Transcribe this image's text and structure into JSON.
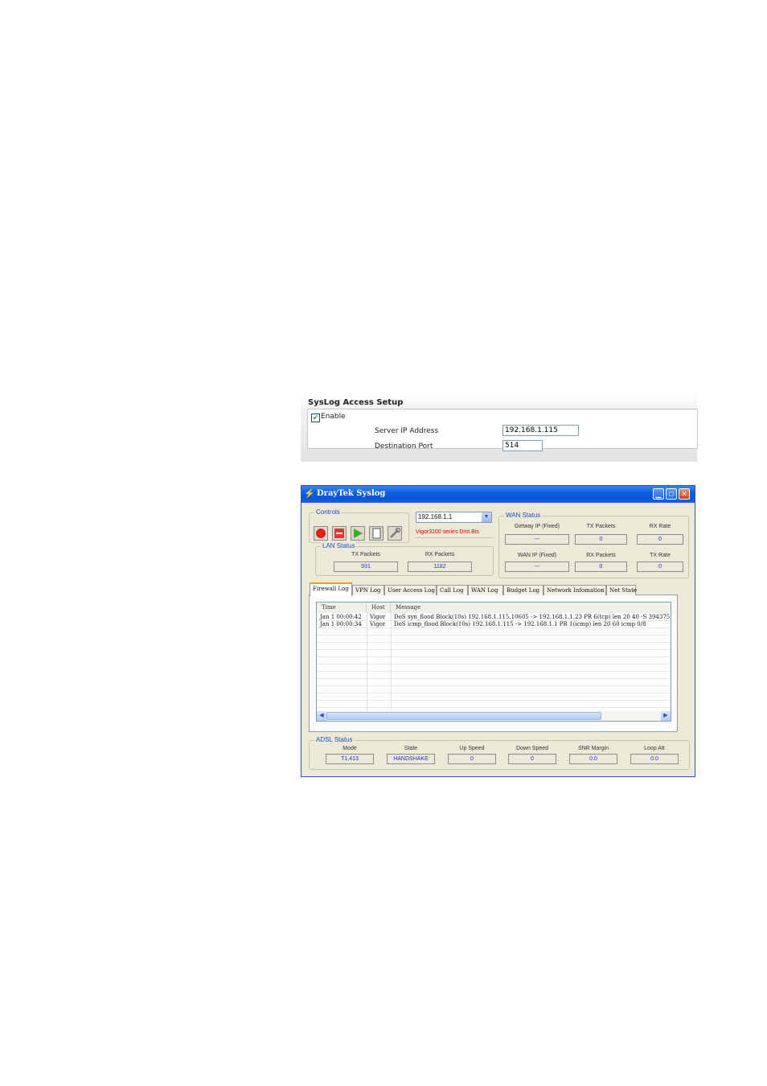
{
  "syslog_setup": {
    "title": "SysLog Access Setup",
    "enable_label": "Enable",
    "enable_checked": true,
    "server_ip_label": "Server IP Address",
    "server_ip_value": "192.168.1.115",
    "dest_port_label": "Destination Port",
    "dest_port_value": "514"
  },
  "window": {
    "title": "DrayTek Syslog",
    "controls_label": "Controls",
    "device_ip": "192.168.1.1",
    "model_text": "Vigor3100   series Dmt.Bis",
    "lan_status": {
      "label": "LAN Status",
      "tx_label": "TX Packets",
      "rx_label": "RX Packets",
      "tx_value": "931",
      "rx_value": "1182"
    },
    "wan_status": {
      "label": "WAN Status",
      "gateway_label": "Getway IP (Fixed)",
      "gateway_value": "---",
      "tx_packets_label": "TX Packets",
      "tx_packets_value": "0",
      "rx_rate_label": "RX Rate",
      "rx_rate_value": "0",
      "wan_ip_label": "WAN IP (Fixed)",
      "wan_ip_value": "---",
      "rx_packets_label": "RX Packets",
      "rx_packets_value": "0",
      "tx_rate_label": "TX Rate",
      "tx_rate_value": "0"
    },
    "tabs": [
      {
        "label": "Firewall Log",
        "active": true
      },
      {
        "label": "VPN Log"
      },
      {
        "label": "User Access Log"
      },
      {
        "label": "Call Log"
      },
      {
        "label": "WAN Log"
      },
      {
        "label": "Budget Log"
      },
      {
        "label": "Network Infomation"
      },
      {
        "label": "Net State"
      }
    ],
    "log": {
      "columns": [
        "Time",
        "Host",
        "Message"
      ],
      "rows": [
        {
          "time": "Jan  1 00:00:42",
          "host": "Vigor",
          "message": "DoS syn_flood Block(10s) 192.168.1.115,10605 -> 192.168.1.1,23 PR 6(tcp) len 20 40 -S 3943751"
        },
        {
          "time": "Jan  1 00:00:34",
          "host": "Vigor",
          "message": "DoS icmp_flood Block(10s) 192.168.1.115 -> 192.168.1.1 PR 1(icmp) len 20 60 icmp 0/8"
        }
      ]
    },
    "adsl_status": {
      "label": "ADSL Status",
      "mode_label": "Mode",
      "mode_value": "T1.413",
      "state_label": "State",
      "state_value": "HANDSHAKE",
      "up_label": "Up Speed",
      "up_value": "0",
      "down_label": "Down Speed",
      "down_value": "0",
      "snr_label": "SNR Margin",
      "snr_value": "0.0",
      "loop_label": "Loop Att",
      "loop_value": "0.0"
    }
  }
}
